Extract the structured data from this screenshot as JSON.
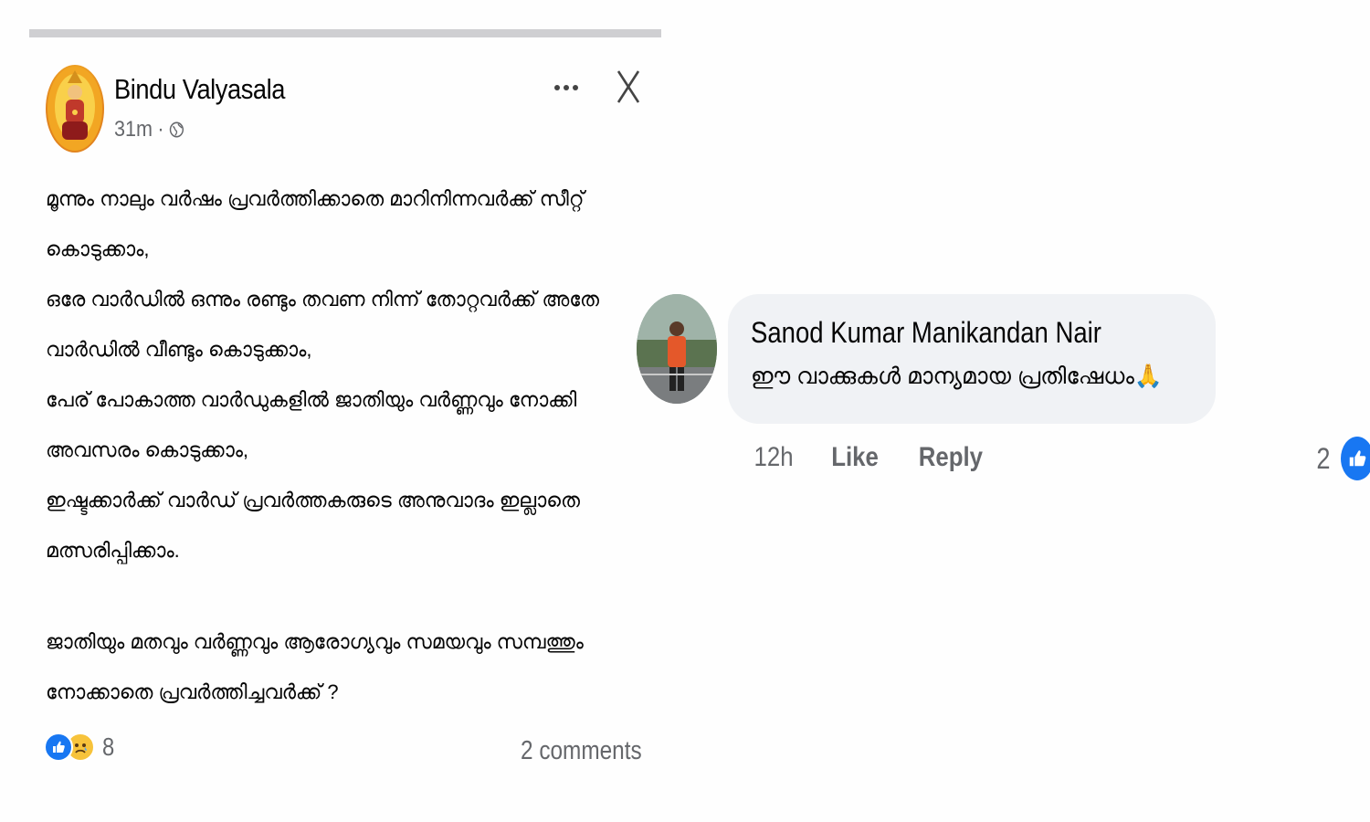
{
  "post": {
    "author": "Bindu Valyasala",
    "time": "31m",
    "separator": "·",
    "body_lines": [
      "മൂന്നും നാലും വർഷം പ്രവർത്തിക്കാതെ മാറിനിന്നവർക്ക് സീറ്റ്",
      "കൊടുക്കാം,",
      " ഒരേ വാർഡിൽ ഒന്നും രണ്ടും തവണ നിന്ന് തോറ്റവർക്ക് അതേ",
      "വാർഡിൽ വീണ്ടും കൊടുക്കാം,",
      "പേര് പോകാത്ത വാർഡുകളിൽ ജാതിയും വർണ്ണവും നോക്കി",
      "അവസരം കൊടുക്കാം,",
      "ഇഷ്ടക്കാർക്ക് വാർഡ് പ്രവർത്തകരുടെ അനുവാദം ഇല്ലാതെ",
      "മത്സരിപ്പിക്കാം."
    ],
    "body_lines_2": [
      "ജാതിയും മതവും വർണ്ണവും ആരോഗ്യവും സമയവും സമ്പത്തും",
      "നോക്കാതെ പ്രവർത്തിച്ചവർക്ക് ?"
    ],
    "reaction_count": "8",
    "comments_label": "2 comments"
  },
  "comment": {
    "author": "Sanod Kumar Manikandan Nair",
    "text": "ഈ വാക്കുകൾ മാന്യമായ പ്രതിഷേധം🙏",
    "time": "12h",
    "like_label": "Like",
    "reply_label": "Reply",
    "like_count": "2"
  },
  "colors": {
    "facebook_blue": "#1877f2",
    "secondary_text": "#65676b",
    "bubble_bg": "#f0f2f5"
  },
  "icons": [
    "more-options-icon",
    "close-icon",
    "globe-icon",
    "like-reaction-icon",
    "sad-reaction-icon"
  ]
}
